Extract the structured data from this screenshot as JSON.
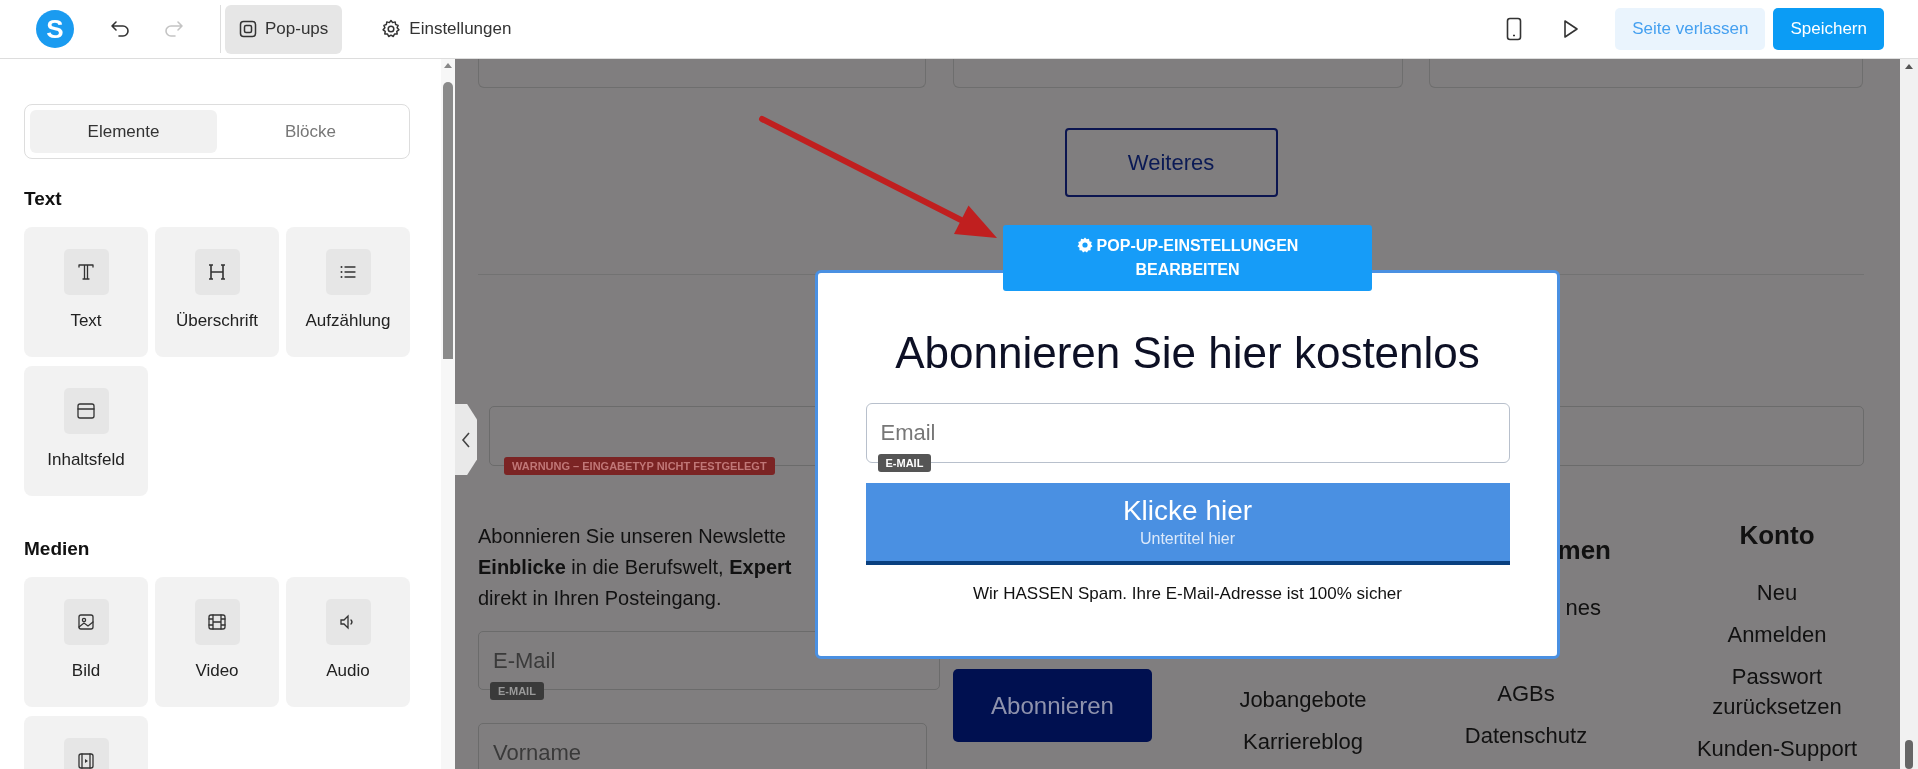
{
  "toolbar": {
    "logo": "S",
    "undo": {
      "disabled": false
    },
    "redo": {
      "disabled": true
    },
    "tabs": [
      {
        "label": "Pop-ups",
        "kind": "popups",
        "selected": true
      },
      {
        "label": "Einstellungen",
        "kind": "settings",
        "selected": false
      }
    ],
    "buttons": [
      {
        "label": "Seite verlassen",
        "kind": "secondary"
      },
      {
        "label": "Speichern",
        "kind": "primary"
      }
    ]
  },
  "sidebar": {
    "tabs": [
      {
        "label": "Elemente",
        "selected": true
      },
      {
        "label": "Blöcke",
        "selected": false
      }
    ],
    "sections": [
      {
        "title": "Text",
        "items": [
          {
            "label": "Text",
            "kind": "text"
          },
          {
            "label": "Überschrift",
            "kind": "heading"
          },
          {
            "label": "Aufzählung",
            "kind": "list"
          },
          {
            "label": "Inhaltsfeld",
            "kind": "content"
          }
        ]
      },
      {
        "title": "Medien",
        "items": [
          {
            "label": "Bild",
            "kind": "image"
          },
          {
            "label": "Video",
            "kind": "video"
          },
          {
            "label": "Audio",
            "kind": "audio"
          },
          {
            "kind": "embed"
          }
        ]
      }
    ]
  },
  "page": {
    "more_button": "Weiteres",
    "warning": "WARNUNG – EINGABETYP NICHT FESTGELEGT",
    "intro": "Abonnieren Sie unseren Newslette\n**Einblicke** in die Berufswelt, **Expert**\ndirekt in Ihren Posteingang.",
    "fields": [
      {
        "placeholder": "E-Mail",
        "badge": "E-MAIL"
      },
      {
        "placeholder": "Vorname"
      }
    ],
    "subscribe_button": "Abonnieren",
    "footer_columns": [
      {
        "items": [
          "Jobangebote",
          "Karriereblog"
        ]
      },
      {
        "title": "men",
        "items": [
          "nes",
          "AGBs",
          "Datenschutz"
        ]
      },
      {
        "title": "Konto",
        "items": [
          "Neu",
          "Anmelden",
          "Passwort zurücksetzen",
          "Kunden-Support"
        ]
      }
    ]
  },
  "popup": {
    "settings_tab": "POP-UP-EINSTELLUNGEN BEARBEITEN",
    "title": "Abonnieren Sie hier kostenlos",
    "field": {
      "placeholder": "Email",
      "badge": "E-MAIL"
    },
    "button": {
      "label": "Klicke hier",
      "subtitle": "Untertitel hier"
    },
    "note": "Wir HASSEN Spam. Ihre E-Mail-Adresse ist 100% sicher"
  }
}
